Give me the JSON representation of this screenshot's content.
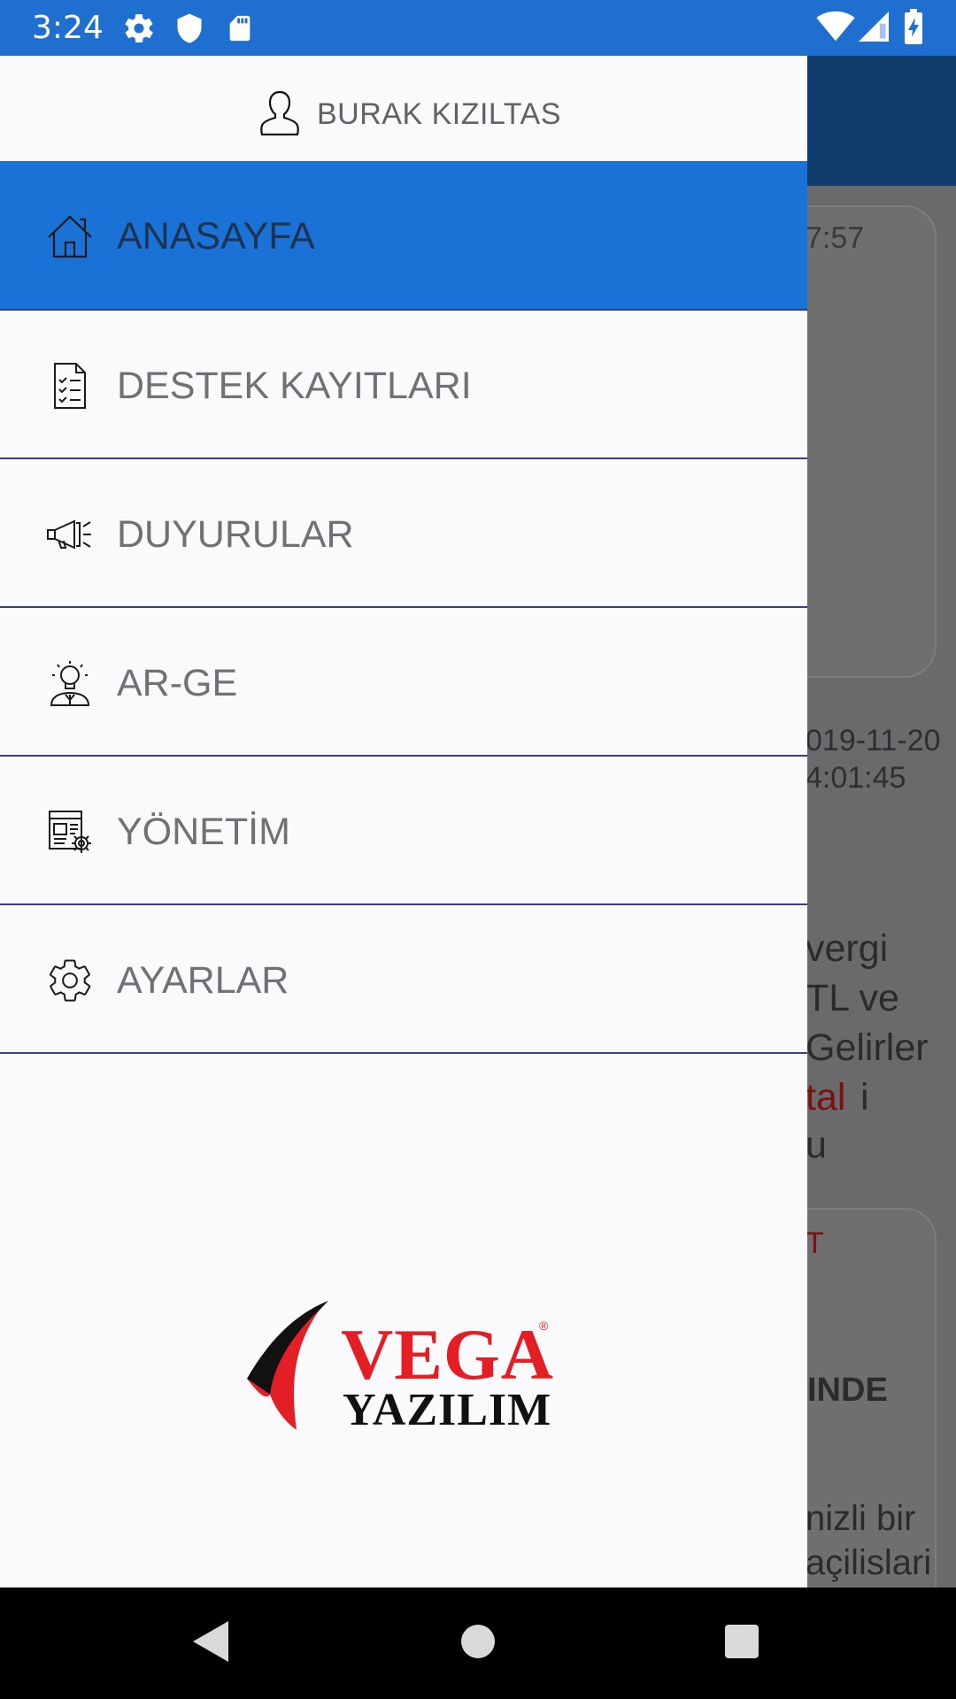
{
  "status_bar": {
    "time": "3:24",
    "icons": [
      "gear-icon",
      "shield-icon",
      "sd-card-icon",
      "wifi-icon",
      "signal-icon",
      "battery-icon"
    ]
  },
  "drawer": {
    "user_name": "BURAK KIZILTAS",
    "menu": [
      {
        "label": "ANASAYFA",
        "icon": "home-icon",
        "active": true
      },
      {
        "label": "DESTEK KAYITLARI",
        "icon": "checklist-document-icon",
        "active": false
      },
      {
        "label": "DUYURULAR",
        "icon": "megaphone-icon",
        "active": false
      },
      {
        "label": "AR-GE",
        "icon": "idea-person-icon",
        "active": false
      },
      {
        "label": "YÖNETİM",
        "icon": "management-document-icon",
        "active": false
      },
      {
        "label": "AYARLAR",
        "icon": "gear-icon",
        "active": false
      }
    ],
    "logo": {
      "line1": "VEGA",
      "line2": "YAZILIM",
      "mark": "®"
    }
  },
  "background": {
    "time1": "7:57",
    "date2": "019-11-20",
    "time2": "4:01:45",
    "text_lines": [
      "vergi",
      "TL ve",
      "Gelirler",
      "tal",
      "i",
      "u"
    ],
    "red_label": "T",
    "bold_text": "INDE",
    "text_lines2": [
      "nizli bir",
      "açilislari"
    ]
  },
  "colors": {
    "status_bar": "#1f6fd1",
    "active_item": "#1b72d6",
    "divider": "#3a3a9e",
    "logo_red": "#e31e24"
  },
  "nav_bar": {
    "buttons": [
      "back-icon",
      "home-circle-icon",
      "recents-icon"
    ]
  }
}
